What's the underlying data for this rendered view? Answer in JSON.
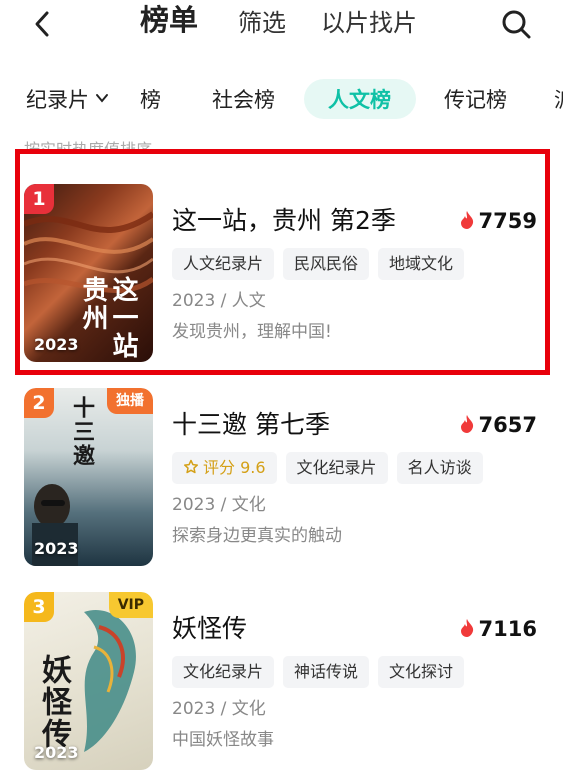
{
  "topbar": {
    "tabs": [
      "榜单",
      "筛选",
      "以片找片"
    ],
    "back_icon": "back-chevron-icon",
    "search_icon": "search-icon"
  },
  "categories": {
    "documentary": "纪录片",
    "partial_prev": "榜",
    "items": [
      "社会榜",
      "人文榜",
      "传记榜"
    ],
    "active": "人文榜",
    "partial_next": "派",
    "accent": "#0fc1a6"
  },
  "hint": "按实时热度值排序",
  "highlight_color": "#e8000b",
  "list": [
    {
      "rank": "1",
      "rank_color": "#e8303a",
      "title": "这一站，贵州 第2季",
      "heat": "7759",
      "tags": [
        "人文纪录片",
        "民风民俗",
        "地域文化"
      ],
      "meta": "2023 / 人文",
      "desc": "发现贵州，理解中国!",
      "poster_year": "2023",
      "poster_text": "这一站 贵州"
    },
    {
      "rank": "2",
      "rank_color": "#f2712f",
      "badge": "独播",
      "title": "十三邀 第七季",
      "heat": "7657",
      "score_label": "评分 9.6",
      "tags": [
        "文化纪录片",
        "名人访谈"
      ],
      "meta": "2023 / 文化",
      "desc": "探索身边更真实的触动",
      "poster_year": "2023",
      "poster_text": "十三邀"
    },
    {
      "rank": "3",
      "rank_color": "#f5b81c",
      "badge": "VIP",
      "title": "妖怪传",
      "heat": "7116",
      "tags": [
        "文化纪录片",
        "神话传说",
        "文化探讨"
      ],
      "meta": "2023 / 文化",
      "desc": "中国妖怪故事",
      "poster_year": "2023",
      "poster_text": "妖怪传"
    }
  ]
}
